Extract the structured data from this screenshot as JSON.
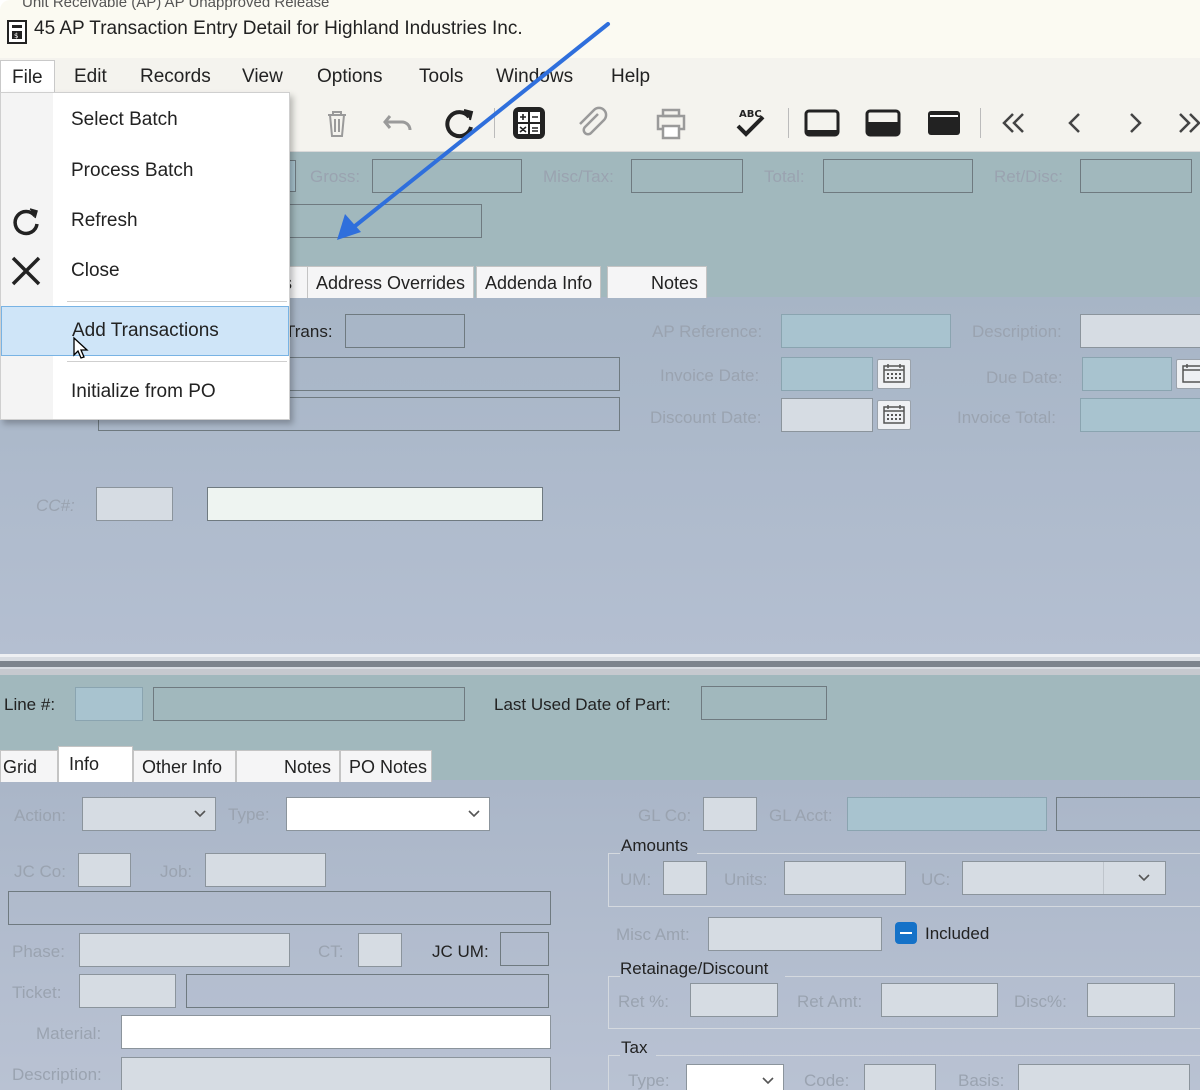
{
  "window": {
    "title": "45 AP Transaction Entry Detail for Highland Industries Inc.",
    "clipped_header_text": "Unit Receivable  (AP) AP Unapproved Release"
  },
  "menubar": [
    "File",
    "Edit",
    "Records",
    "View",
    "Options",
    "Tools",
    "Windows",
    "Help"
  ],
  "file_menu": {
    "items": [
      {
        "label": "Select Batch",
        "icon": ""
      },
      {
        "label": "Process Batch",
        "icon": ""
      },
      {
        "label": "Refresh",
        "icon": "refresh-icon"
      },
      {
        "label": "Close",
        "icon": "close-icon"
      },
      {
        "label": "Add Transactions",
        "icon": "",
        "highlighted": true
      },
      {
        "label": "Initialize from PO",
        "icon": ""
      }
    ]
  },
  "toolbar": {
    "icons": [
      "delete-icon",
      "undo-icon",
      "refresh-icon",
      "calculator-icon",
      "attachment-icon",
      "print-icon",
      "spellcheck-icon",
      "layout-top-icon",
      "layout-split-icon",
      "layout-bottom-icon",
      "first-record-icon",
      "previous-record-icon",
      "next-record-icon",
      "last-record-icon"
    ],
    "spellcheck_badge": "ABC"
  },
  "header_fields": {
    "gross_label": "Gross:",
    "misc_tax_label": "Misc/Tax:",
    "total_label": "Total:",
    "ret_disc_label": "Ret/Disc:"
  },
  "header_tabs": [
    "s",
    "Address Overrides",
    "Addenda Info",
    "Notes"
  ],
  "header_form": {
    "trans_label": "Trans:",
    "ap_reference_label": "AP Reference:",
    "description_label": "Description:",
    "invoice_date_label": "Invoice Date:",
    "due_date_label": "Due Date:",
    "discount_date_label": "Discount Date:",
    "invoice_total_label": "Invoice Total:",
    "cc_label": "CC#:"
  },
  "line_section": {
    "line_label": "Line #:",
    "last_used_label": "Last Used Date of Part:",
    "tabs": [
      "Grid",
      "Info",
      "Other Info",
      "Notes",
      "PO Notes"
    ],
    "selected_tab": "Info"
  },
  "line_form": {
    "action_label": "Action:",
    "type_label": "Type:",
    "gl_co_label": "GL Co:",
    "gl_acct_label": "GL Acct:",
    "amounts_group": "Amounts",
    "jc_co_label": "JC Co:",
    "job_label": "Job:",
    "um_label": "UM:",
    "units_label": "Units:",
    "uc_label": "UC:",
    "phase_label": "Phase:",
    "ct_label": "CT:",
    "jc_um_label": "JC UM:",
    "misc_amt_label": "Misc Amt:",
    "included_label": "Included",
    "retainage_group": "Retainage/Discount",
    "ticket_label": "Ticket:",
    "ret_pct_label": "Ret %:",
    "ret_amt_label": "Ret Amt:",
    "disc_pct_label": "Disc%:",
    "material_label": "Material:",
    "tax_group": "Tax",
    "description_label": "Description:",
    "tax_type_label": "Type:",
    "code_label": "Code:",
    "basis_label": "Basis:"
  },
  "colors": {
    "annotation_arrow": "#2f6fdc",
    "menu_highlight": "#cfe5f8",
    "panel_teal": "#a1b8bd",
    "panel_blue": "#b4bfd1"
  }
}
